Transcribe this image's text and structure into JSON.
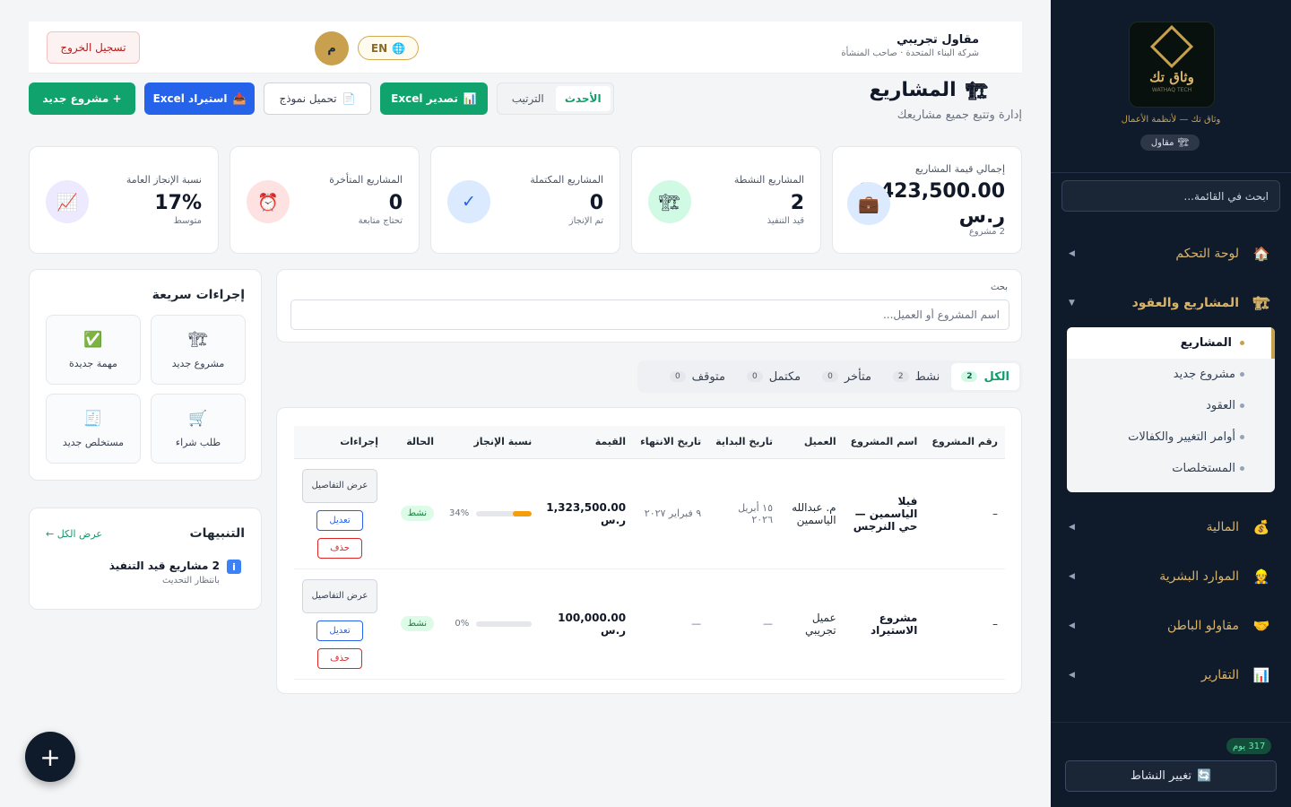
{
  "topbar": {
    "logout_label": "تسجيل الخروج",
    "user_name": "مقاول تجريبي",
    "user_sub": "شركة البناء المتحدة · صاحب المنشأة",
    "avatar_letter": "م",
    "lang_label": "EN"
  },
  "header": {
    "title": "المشاريع",
    "subtitle": "إدارة وتتبع جميع مشاريعك",
    "sort_newest": "الأحدث",
    "sort_label": "الترتيب",
    "export_label": "تصدير Excel",
    "template_label": "تحميل نموذج",
    "import_label": "استيراد Excel",
    "new_project_label": "+ مشروع جديد"
  },
  "stats": [
    {
      "label": "إجمالي قيمة المشاريع",
      "value": "1,423,500.00 ر.س",
      "sub": "2 مشروع",
      "icon": "briefcase-icon"
    },
    {
      "label": "المشاريع النشطة",
      "value": "2",
      "sub": "قيد التنفيذ",
      "icon": "construction-icon"
    },
    {
      "label": "المشاريع المكتملة",
      "value": "0",
      "sub": "تم الإنجاز",
      "icon": "check-icon"
    },
    {
      "label": "المشاريع المتأخرة",
      "value": "0",
      "sub": "تحتاج متابعة",
      "icon": "alarm-icon"
    },
    {
      "label": "نسبة الإنجاز العامة",
      "value": "17%",
      "sub": "متوسط",
      "icon": "chart-icon"
    }
  ],
  "quick": {
    "title": "إجراءات سريعة",
    "items": [
      "مشروع جديد",
      "مهمة جديدة",
      "طلب شراء",
      "مستخلص جديد"
    ]
  },
  "alerts": {
    "title": "التنبيهات",
    "view_all": "عرض الكل ←",
    "item_title": "2 مشاريع قيد التنفيذ",
    "item_sub": "بانتظار التحديث"
  },
  "search": {
    "label": "بحث",
    "placeholder": "اسم المشروع أو العميل..."
  },
  "tabs": [
    {
      "label": "الكل",
      "count": "2"
    },
    {
      "label": "نشط",
      "count": "2"
    },
    {
      "label": "متأخر",
      "count": "0"
    },
    {
      "label": "مكتمل",
      "count": "0"
    },
    {
      "label": "متوقف",
      "count": "0"
    }
  ],
  "table": {
    "headers": [
      "رقم المشروع",
      "اسم المشروع",
      "العميل",
      "تاريخ البداية",
      "تاريخ الانتهاء",
      "القيمة",
      "نسبة الإنجاز",
      "الحالة",
      "إجراءات"
    ],
    "rows": [
      {
        "number": "–",
        "name": "فيلا الياسمين — حي النرجس",
        "client": "م. عبدالله الياسمين",
        "start": "١٥ أبريل ٢٠٢٦",
        "end": "٩ فبراير ٢٠٢٧",
        "value": "1,323,500.00 ر.س",
        "progress": 34,
        "progress_label": "34%",
        "status": "نشط"
      },
      {
        "number": "–",
        "name": "مشروع الاستيراد",
        "client": "عميل تجريبي",
        "start": "—",
        "end": "—",
        "value": "100,000.00 ر.س",
        "progress": 0,
        "progress_label": "0%",
        "status": "نشط"
      }
    ],
    "view_label": "عرض التفاصيل",
    "edit_label": "تعديل",
    "delete_label": "حذف"
  },
  "sidebar": {
    "brand": "وثاق تك",
    "tagline": "وثاق تك — لأنظمة الأعمال",
    "role": "مقاول",
    "search_placeholder": "ابحث في القائمة...",
    "nav": [
      {
        "label": "لوحة التحكم",
        "icon": "house-icon"
      },
      {
        "label": "المشاريع والعقود",
        "icon": "construction-icon"
      },
      {
        "label": "المالية",
        "icon": "money-bag-icon"
      },
      {
        "label": "الموارد البشرية",
        "icon": "worker-icon"
      },
      {
        "label": "مقاولو الباطن",
        "icon": "handshake-icon"
      },
      {
        "label": "التقارير",
        "icon": "bar-chart-icon"
      }
    ],
    "submenu": [
      "المشاريع",
      "مشروع جديد",
      "العقود",
      "أوامر التغيير والكفالات",
      "المستخلصات"
    ],
    "days_badge": "317 يوم",
    "switch_label": "تغيير النشاط"
  },
  "colors": {
    "primary_green": "#0f9d6b",
    "sidebar_bg": "#0f1a2a",
    "gold": "#c8a14d",
    "import_blue": "#2563eb"
  }
}
